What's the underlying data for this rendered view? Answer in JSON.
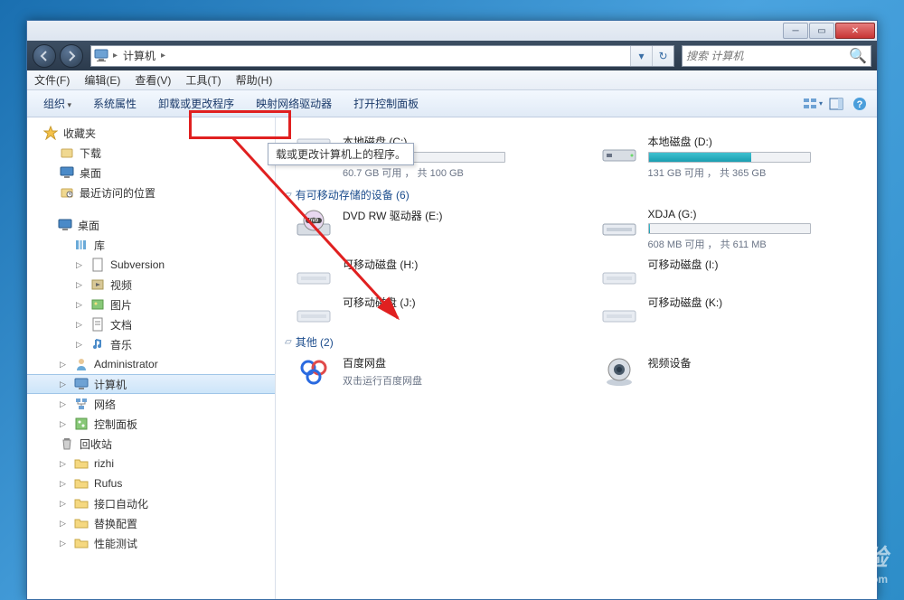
{
  "window": {
    "address": {
      "root": "计算机"
    },
    "search": {
      "placeholder": "搜索 计算机"
    }
  },
  "menubar": {
    "items": [
      "文件(F)",
      "编辑(E)",
      "查看(V)",
      "工具(T)",
      "帮助(H)"
    ]
  },
  "toolbar": {
    "organize": "组织",
    "items": [
      "系统属性",
      "卸载或更改程序",
      "映射网络驱动器",
      "打开控制面板"
    ],
    "tooltip": "载或更改计算机上的程序。"
  },
  "sidebar": {
    "favorites": {
      "label": "收藏夹",
      "items": [
        "下载",
        "桌面",
        "最近访问的位置"
      ]
    },
    "desktop": {
      "label": "桌面",
      "libraries": {
        "label": "库",
        "items": [
          "Subversion",
          "视频",
          "图片",
          "文档",
          "音乐"
        ]
      },
      "user": "Administrator",
      "computer": "计算机",
      "network": "网络",
      "controlpanel": "控制面板",
      "recyclebin": "回收站",
      "folders": [
        "rizhi",
        "Rufus",
        "接口自动化",
        "替换配置",
        "性能测试"
      ]
    }
  },
  "content": {
    "localdisks": [
      {
        "name": "本地磁盘 (C:)",
        "usage": "60.7 GB 可用 ， 共 100 GB",
        "fill": 40
      },
      {
        "name": "本地磁盘 (D:)",
        "usage": "131 GB 可用 ， 共 365 GB",
        "fill": 64
      }
    ],
    "removable": {
      "header": "有可移动存储的设备 (6)",
      "items": [
        {
          "name": "DVD RW 驱动器 (E:)",
          "type": "dvd"
        },
        {
          "name": "XDJA (G:)",
          "usage": "608 MB 可用 ， 共 611 MB",
          "fill": 1,
          "type": "usb"
        },
        {
          "name": "可移动磁盘 (H:)",
          "type": "removable"
        },
        {
          "name": "可移动磁盘 (I:)",
          "type": "removable"
        },
        {
          "name": "可移动磁盘 (J:)",
          "type": "removable"
        },
        {
          "name": "可移动磁盘 (K:)",
          "type": "removable"
        }
      ]
    },
    "other": {
      "header": "其他 (2)",
      "items": [
        {
          "name": "百度网盘",
          "sub": "双击运行百度网盘",
          "type": "baidu"
        },
        {
          "name": "视频设备",
          "type": "camera"
        }
      ]
    }
  },
  "watermark": {
    "main": "Baidu 经验",
    "sub": "jingyan.baidu.com"
  }
}
